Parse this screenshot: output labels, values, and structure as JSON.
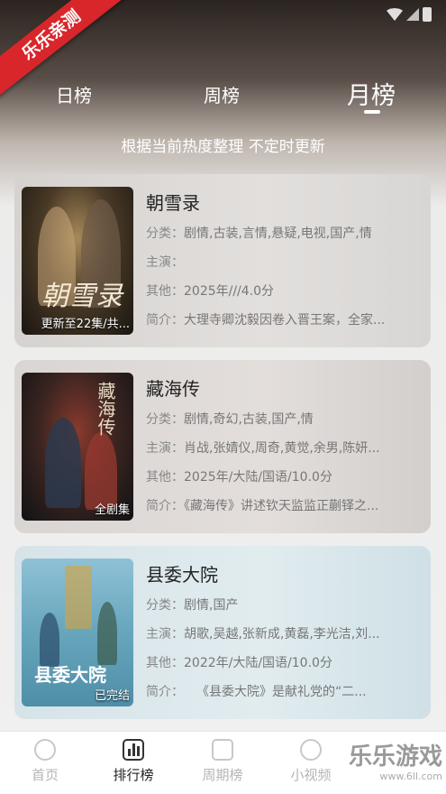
{
  "watermark": {
    "ribbon": "乐乐亲测",
    "brand": "乐乐游戏",
    "url": "www.6ll.com"
  },
  "tabs": [
    {
      "label": "日榜",
      "active": false
    },
    {
      "label": "周榜",
      "active": false
    },
    {
      "label": "月榜",
      "active": true
    }
  ],
  "subtitle": "根据当前热度整理 不定时更新",
  "items": [
    {
      "title": "朝雪录",
      "poster_caption": "更新至22集/共...",
      "poster_art": "朝雪录",
      "genre_label": "分类：",
      "genre": "剧情,古装,言情,悬疑,电视,国产,情",
      "cast_label": "主演：",
      "cast": "",
      "other_label": "其他：",
      "other": "2025年///4.0分",
      "intro_label": "简介：",
      "intro": "大理寺卿沈毅因卷入晋王案，全家..."
    },
    {
      "title": "藏海传",
      "poster_caption": "全剧集",
      "poster_art": "藏海传",
      "genre_label": "分类：",
      "genre": "剧情,奇幻,古装,国产,情",
      "cast_label": "主演：",
      "cast": "肖战,张婧仪,周奇,黄觉,余男,陈妍...",
      "other_label": "其他：",
      "other": "2025年/大陆/国语/10.0分",
      "intro_label": "简介：",
      "intro": "《藏海传》讲述钦天监监正蒯铎之..."
    },
    {
      "title": "县委大院",
      "poster_caption": "已完结",
      "poster_art": "县委大院",
      "genre_label": "分类：",
      "genre": "剧情,国产",
      "cast_label": "主演：",
      "cast": "胡歌,吴越,张新成,黄磊,李光洁,刘...",
      "other_label": "其他：",
      "other": "2022年/大陆/国语/10.0分",
      "intro_label": "简介：",
      "intro": "　　《县委大院》是献礼党的“二..."
    }
  ],
  "bottom_nav": [
    {
      "label": "首页",
      "icon": "home-icon",
      "active": false
    },
    {
      "label": "排行榜",
      "icon": "ranking-icon",
      "active": true
    },
    {
      "label": "周期榜",
      "icon": "calendar-icon",
      "active": false
    },
    {
      "label": "小视频",
      "icon": "video-icon",
      "active": false
    }
  ]
}
